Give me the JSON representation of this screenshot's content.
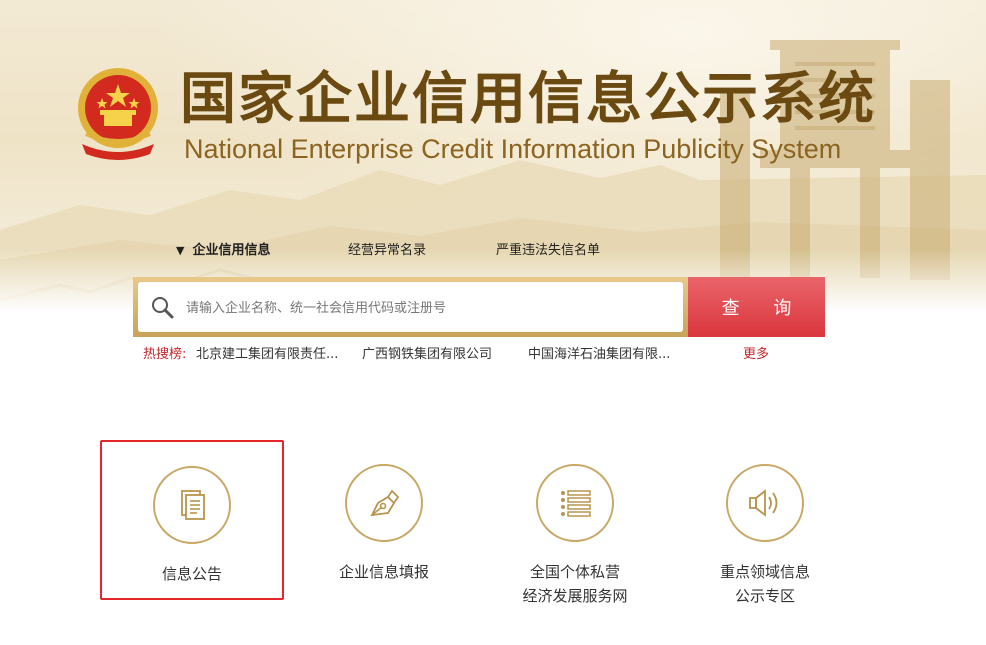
{
  "header": {
    "title_cn": "国家企业信用信息公示系统",
    "title_en": "National Enterprise Credit Information Publicity System"
  },
  "search": {
    "tabs": [
      {
        "label": "企业信用信息",
        "active": true
      },
      {
        "label": "经营异常名录",
        "active": false
      },
      {
        "label": "严重违法失信名单",
        "active": false
      }
    ],
    "placeholder": "请输入企业名称、统一社会信用代码或注册号",
    "button_label": "查 询"
  },
  "hot_search": {
    "label": "热搜榜:",
    "items": [
      "北京建工集团有限责任...",
      "广西钢铁集团有限公司",
      "中国海洋石油集团有限..."
    ],
    "more_label": "更多"
  },
  "features": [
    {
      "line1": "信息公告",
      "line2": "",
      "icon": "document-icon",
      "selected": true
    },
    {
      "line1": "企业信息填报",
      "line2": "",
      "icon": "pen-nib-icon",
      "selected": false
    },
    {
      "line1": "全国个体私营",
      "line2": "经济发展服务网",
      "icon": "list-icon",
      "selected": false
    },
    {
      "line1": "重点领域信息",
      "line2": "公示专区",
      "icon": "speaker-icon",
      "selected": false
    }
  ],
  "colors": {
    "title": "#6b4a12",
    "accent_gold": "#c9a867",
    "search_button": "#d9363d",
    "hot_label": "#c7262c",
    "selection_border": "#e3262a"
  }
}
